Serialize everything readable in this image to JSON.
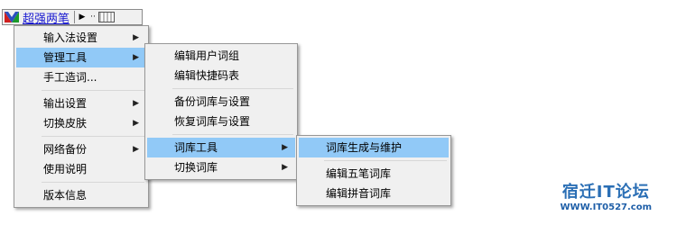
{
  "toolbar": {
    "ime_name": "超强两笔",
    "buttons": [
      "arrow-icon",
      "dots-icon",
      "keyboard-icon"
    ]
  },
  "main_menu": {
    "groups": [
      [
        {
          "label": "输入法设置",
          "arrow": true
        },
        {
          "label": "管理工具",
          "arrow": true,
          "highlight": true
        },
        {
          "label": "手工造词...",
          "arrow": false
        }
      ],
      [
        {
          "label": "输出设置",
          "arrow": true
        },
        {
          "label": "切换皮肤",
          "arrow": true
        }
      ],
      [
        {
          "label": "网络备份",
          "arrow": true
        },
        {
          "label": "使用说明",
          "arrow": false
        }
      ],
      [
        {
          "label": "版本信息",
          "arrow": false
        }
      ]
    ]
  },
  "sub_menu": {
    "groups": [
      [
        {
          "label": "编辑用户词组",
          "arrow": false
        },
        {
          "label": "编辑快捷码表",
          "arrow": false
        }
      ],
      [
        {
          "label": "备份词库与设置",
          "arrow": false
        },
        {
          "label": "恢复词库与设置",
          "arrow": false
        }
      ],
      [
        {
          "label": "词库工具",
          "arrow": true,
          "highlight": true
        },
        {
          "label": "切换词库",
          "arrow": true
        }
      ]
    ]
  },
  "sub_sub_menu": {
    "groups": [
      [
        {
          "label": "词库生成与维护",
          "arrow": false,
          "highlight": true
        }
      ],
      [
        {
          "label": "编辑五笔词库",
          "arrow": false
        },
        {
          "label": "编辑拼音词库",
          "arrow": false
        }
      ]
    ]
  },
  "watermark": {
    "title": "宿迁IT论坛",
    "url": "WWW.IT0527.com"
  },
  "colors": {
    "highlight": "#91c9f7",
    "menu_bg": "#f0f0f0",
    "ime_name": "#1a1ad0",
    "watermark": "#2b6fb5"
  }
}
